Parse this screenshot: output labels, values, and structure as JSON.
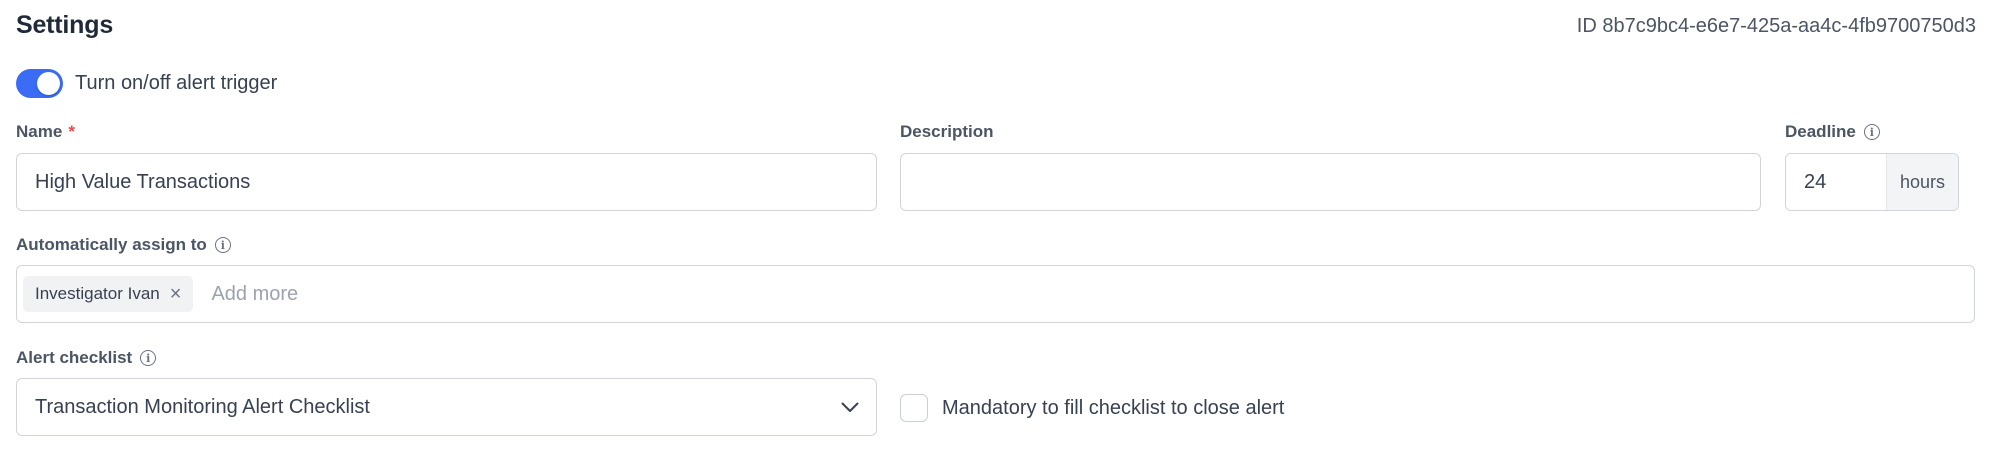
{
  "header": {
    "title": "Settings",
    "id_text": "ID 8b7c9bc4-e6e7-425a-aa4c-4fb9700750d3"
  },
  "toggle": {
    "label": "Turn on/off alert trigger",
    "enabled": true
  },
  "fields": {
    "name": {
      "label": "Name",
      "required_mark": "*",
      "value": "High Value Transactions"
    },
    "description": {
      "label": "Description",
      "value": ""
    },
    "deadline": {
      "label": "Deadline",
      "value": "24",
      "unit": "hours"
    },
    "assign": {
      "label": "Automatically assign to",
      "chips": [
        "Investigator Ivan"
      ],
      "placeholder": "Add more"
    },
    "checklist": {
      "label": "Alert checklist",
      "selected": "Transaction Monitoring Alert Checklist"
    },
    "mandatory": {
      "label": "Mandatory to fill checklist to close alert",
      "checked": false
    }
  },
  "colors": {
    "accent": "#3b6cf6",
    "required": "#e5484d",
    "border": "#d1d5db",
    "chip_bg": "#f1f2f4",
    "unit_bg": "#f3f4f6"
  },
  "icons": [
    "info-icon",
    "close-icon",
    "chevron-down-icon"
  ]
}
